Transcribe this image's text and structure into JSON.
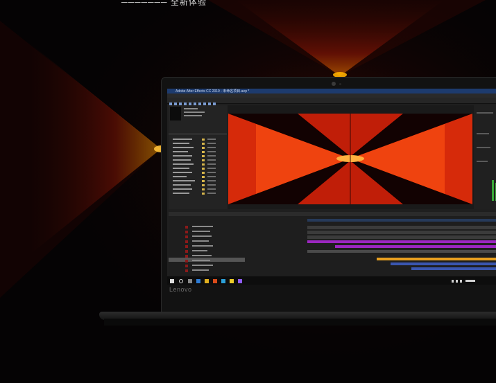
{
  "caption": "─────── 全新体验",
  "screen": {
    "window_title": "Adobe After Effects CC 2019 - 未命名项目.aep *",
    "project_items": 14,
    "timeline_layers": 12
  },
  "brand": "Lenovo",
  "colors": {
    "glow": "#ff3b0a",
    "glow_core": "#ffb000",
    "background": "#050304",
    "screen_bg": "#1f1f1f",
    "titlebar": "#1d3b6e"
  }
}
